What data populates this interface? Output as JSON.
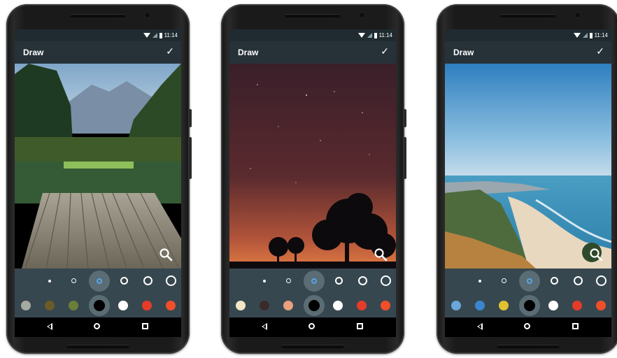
{
  "phones": [
    {
      "status": {
        "time": "11:14"
      },
      "appbar": {
        "title": "Draw",
        "confirm_glyph": "✓"
      },
      "photo": "mountain-lake-dock",
      "palette": [
        "#a7a9a3",
        "#6b5b26",
        "#6a7f3a",
        "#000000",
        "#ffffff",
        "#e53c2a",
        "#f04f2a"
      ],
      "selected_color_index": 3,
      "selected_size_index": 2
    },
    {
      "status": {
        "time": "11:14"
      },
      "appbar": {
        "title": "Draw",
        "confirm_glyph": "✓"
      },
      "photo": "night-sky-trees",
      "palette": [
        "#f3e6c6",
        "#3a2a2a",
        "#e8a07e",
        "#000000",
        "#ffffff",
        "#e53c2a",
        "#f04f2a"
      ],
      "selected_color_index": 3,
      "selected_size_index": 2
    },
    {
      "status": {
        "time": "11:14"
      },
      "appbar": {
        "title": "Draw",
        "confirm_glyph": "✓"
      },
      "photo": "coastal-beach",
      "palette": [
        "#6aa6dc",
        "#3b86cf",
        "#e0c12f",
        "#000000",
        "#ffffff",
        "#e53c2a",
        "#f04f2a"
      ],
      "selected_color_index": 3,
      "selected_size_index": 2
    }
  ],
  "icons": {
    "confirm": "check-icon",
    "zoom": "magnifier-icon",
    "nav": [
      "back-icon",
      "home-icon",
      "recents-icon"
    ]
  }
}
